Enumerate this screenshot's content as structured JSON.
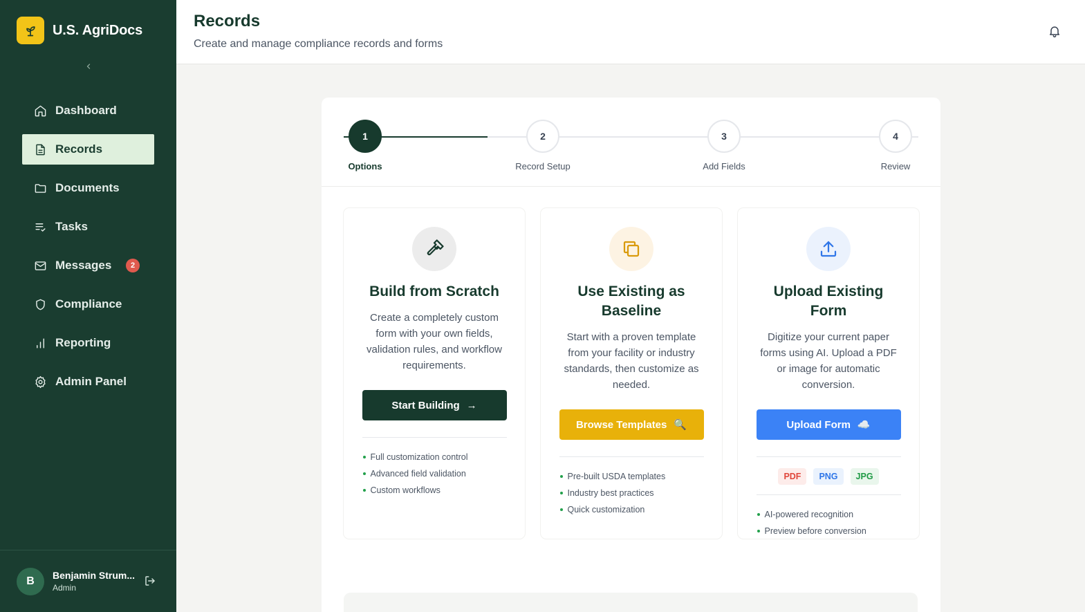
{
  "app": {
    "name": "U.S. AgriDocs"
  },
  "sidebar": {
    "items": [
      {
        "label": "Dashboard"
      },
      {
        "label": "Records"
      },
      {
        "label": "Documents"
      },
      {
        "label": "Tasks"
      },
      {
        "label": "Messages",
        "badge": "2"
      },
      {
        "label": "Compliance"
      },
      {
        "label": "Reporting"
      },
      {
        "label": "Admin Panel"
      }
    ],
    "active": "Records"
  },
  "user": {
    "initial": "B",
    "name": "Benjamin Strum...",
    "role": "Admin"
  },
  "header": {
    "title": "Records",
    "subtitle": "Create and manage compliance records and forms"
  },
  "stepper": {
    "steps": [
      {
        "number": "1",
        "label": "Options"
      },
      {
        "number": "2",
        "label": "Record Setup"
      },
      {
        "number": "3",
        "label": "Add Fields"
      },
      {
        "number": "4",
        "label": "Review"
      }
    ],
    "current": 1
  },
  "options": {
    "scratch": {
      "title": "Build from Scratch",
      "description": "Create a completely custom form with your own fields, validation rules, and workflow requirements.",
      "button": "Start Building",
      "button_icon": "→",
      "features": [
        "Full customization control",
        "Advanced field validation",
        "Custom workflows"
      ]
    },
    "baseline": {
      "title": "Use Existing as Baseline",
      "description": "Start with a proven template from your facility or industry standards, then customize as needed.",
      "button": "Browse Templates",
      "button_icon": "🔍",
      "features": [
        "Pre-built USDA templates",
        "Industry best practices",
        "Quick customization"
      ]
    },
    "upload": {
      "title": "Upload Existing Form",
      "description": "Digitize your current paper forms using AI. Upload a PDF or image for automatic conversion.",
      "button": "Upload Form",
      "button_icon": "☁️",
      "formats": [
        "PDF",
        "PNG",
        "JPG"
      ],
      "features": [
        "AI-powered recognition",
        "Preview before conversion"
      ]
    }
  },
  "colors": {
    "sidebar_bg": "#1a3d30",
    "active_nav_bg": "#dff0dd",
    "brand_yellow": "#f2c418",
    "primary_dark": "#173a2d",
    "template_yellow": "#e8b10a",
    "upload_blue": "#3b82f6",
    "badge_red": "#e05a4e"
  }
}
